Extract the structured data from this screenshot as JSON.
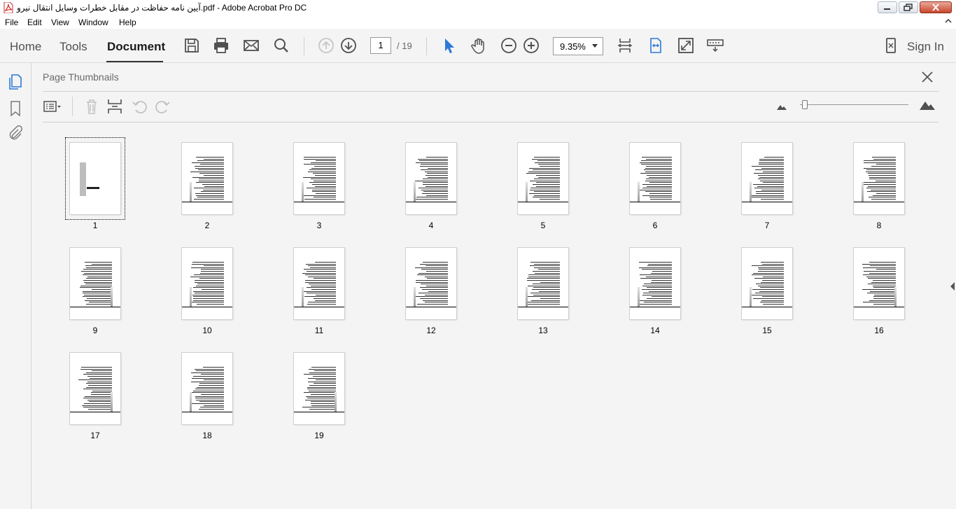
{
  "window": {
    "title": "آیین نامه حفاظت در مقابل خطرات وسایل انتقال نیرو.pdf - Adobe Acrobat Pro DC"
  },
  "menu": [
    "File",
    "Edit",
    "View",
    "Window",
    "Help"
  ],
  "tabs": [
    "Home",
    "Tools",
    "Document"
  ],
  "active_tab": "Document",
  "page_nav": {
    "current": "1",
    "total": "/ 19"
  },
  "zoom": {
    "value": "9.35%"
  },
  "sign_in": "Sign In",
  "panel": {
    "title": "Page Thumbnails"
  },
  "thumbnail_slider": {
    "level": 0.02
  },
  "thumbnails": [
    "1",
    "2",
    "3",
    "4",
    "5",
    "6",
    "7",
    "8",
    "9",
    "10",
    "11",
    "12",
    "13",
    "14",
    "15",
    "16",
    "17",
    "18",
    "19"
  ],
  "selected_thumbnail": "1",
  "colors": {
    "accent": "#2d7ad6",
    "pdf_red": "#d8261b"
  }
}
